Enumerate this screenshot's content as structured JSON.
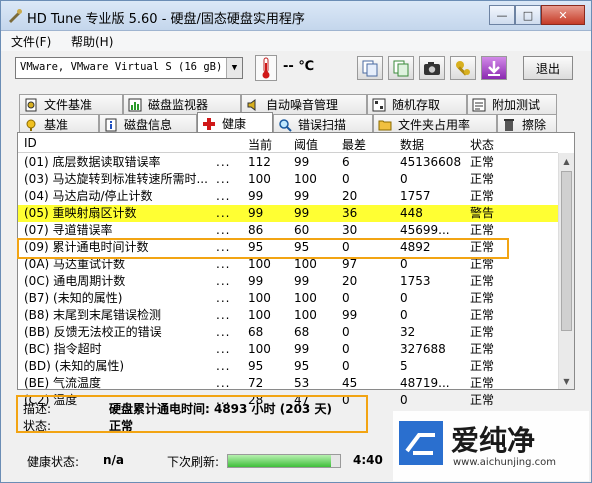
{
  "window": {
    "title": "HD Tune 专业版 5.60 - 硬盘/固态硬盘实用程序",
    "minimize": "—",
    "maximize": "□",
    "close": "✕"
  },
  "menu": {
    "file": "文件(F)",
    "help": "帮助(H)"
  },
  "toolbar": {
    "drive": "VMware, VMware Virtual S (16 gB)",
    "temperature": "-- ℃",
    "exit": "退出"
  },
  "tabs_top": [
    {
      "label": "文件基准",
      "icon": "file-benchmark-icon"
    },
    {
      "label": "磁盘监视器",
      "icon": "disk-monitor-icon"
    },
    {
      "label": "自动噪音管理",
      "icon": "speaker-icon"
    },
    {
      "label": "随机存取",
      "icon": "random-access-icon"
    },
    {
      "label": "附加测试",
      "icon": "extra-tests-icon"
    }
  ],
  "tabs_bottom": [
    {
      "label": "基准",
      "icon": "benchmark-icon"
    },
    {
      "label": "磁盘信息",
      "icon": "info-icon"
    },
    {
      "label": "健康",
      "icon": "health-cross-icon"
    },
    {
      "label": "错误扫描",
      "icon": "magnifier-icon"
    },
    {
      "label": "文件夹占用率",
      "icon": "folder-icon"
    },
    {
      "label": "擦除",
      "icon": "trash-icon"
    }
  ],
  "columns": {
    "id": "ID",
    "current": "当前",
    "threshold": "阈值",
    "worst": "最差",
    "data": "数据",
    "status": "状态"
  },
  "rows": [
    {
      "id": "(01) 底层数据读取错误率",
      "dots": "...",
      "current": "112",
      "threshold": "99",
      "worst": "6",
      "data": "45136608",
      "status": "正常"
    },
    {
      "id": "(03) 马达旋转到标准转速所需时...",
      "dots": "...",
      "current": "100",
      "threshold": "100",
      "worst": "0",
      "data": "0",
      "status": "正常"
    },
    {
      "id": "(04) 马达启动/停止计数",
      "dots": "...",
      "current": "99",
      "threshold": "99",
      "worst": "20",
      "data": "1757",
      "status": "正常"
    },
    {
      "id": "(05) 重映射扇区计数",
      "dots": "...",
      "current": "99",
      "threshold": "99",
      "worst": "36",
      "data": "448",
      "status": "警告"
    },
    {
      "id": "(07) 寻道错误率",
      "dots": "...",
      "current": "86",
      "threshold": "60",
      "worst": "30",
      "data": "45699...",
      "status": "正常"
    },
    {
      "id": "(09) 累计通电时间计数",
      "dots": "...",
      "current": "95",
      "threshold": "95",
      "worst": "0",
      "data": "4892",
      "status": "正常"
    },
    {
      "id": "(0A) 马达重试计数",
      "dots": "...",
      "current": "100",
      "threshold": "100",
      "worst": "97",
      "data": "0",
      "status": "正常"
    },
    {
      "id": "(0C) 通电周期计数",
      "dots": "...",
      "current": "99",
      "threshold": "99",
      "worst": "20",
      "data": "1753",
      "status": "正常"
    },
    {
      "id": "(B7) (未知的属性)",
      "dots": "...",
      "current": "100",
      "threshold": "100",
      "worst": "0",
      "data": "0",
      "status": "正常"
    },
    {
      "id": "(B8) 末尾到末尾错误检测",
      "dots": "...",
      "current": "100",
      "threshold": "100",
      "worst": "99",
      "data": "0",
      "status": "正常"
    },
    {
      "id": "(BB) 反馈无法校正的错误",
      "dots": "...",
      "current": "68",
      "threshold": "68",
      "worst": "0",
      "data": "32",
      "status": "正常"
    },
    {
      "id": "(BC) 指令超时",
      "dots": "...",
      "current": "100",
      "threshold": "99",
      "worst": "0",
      "data": "327688",
      "status": "正常"
    },
    {
      "id": "(BD) (未知的属性)",
      "dots": "...",
      "current": "95",
      "threshold": "95",
      "worst": "0",
      "data": "5",
      "status": "正常"
    },
    {
      "id": "(BE) 气流温度",
      "dots": "...",
      "current": "72",
      "threshold": "53",
      "worst": "45",
      "data": "48719...",
      "status": "正常"
    },
    {
      "id": "(C2) 温度",
      "dots": "...",
      "current": "28",
      "threshold": "47",
      "worst": "0",
      "data": "0",
      "status": "正常"
    }
  ],
  "highlight_row_index": 3,
  "selected_row_index": 5,
  "description": {
    "desc_label": "描述:",
    "desc_value": "硬盘累计通电时间: 4893 小时 (203 天)",
    "status_label": "状态:",
    "status_value": "正常"
  },
  "statusbar": {
    "health_label": "健康状态:",
    "health_value": "n/a",
    "refresh_label": "下次刷新:",
    "refresh_time": "4:40",
    "refresh_progress": 0.92
  },
  "watermark": {
    "brand": "爱纯净",
    "url": "www.aichunjing.com"
  },
  "colors": {
    "highlight": "#ffff33",
    "accent_box": "#f2a413",
    "health_red": "#d01818",
    "progress_green": "#3fbf3a"
  }
}
